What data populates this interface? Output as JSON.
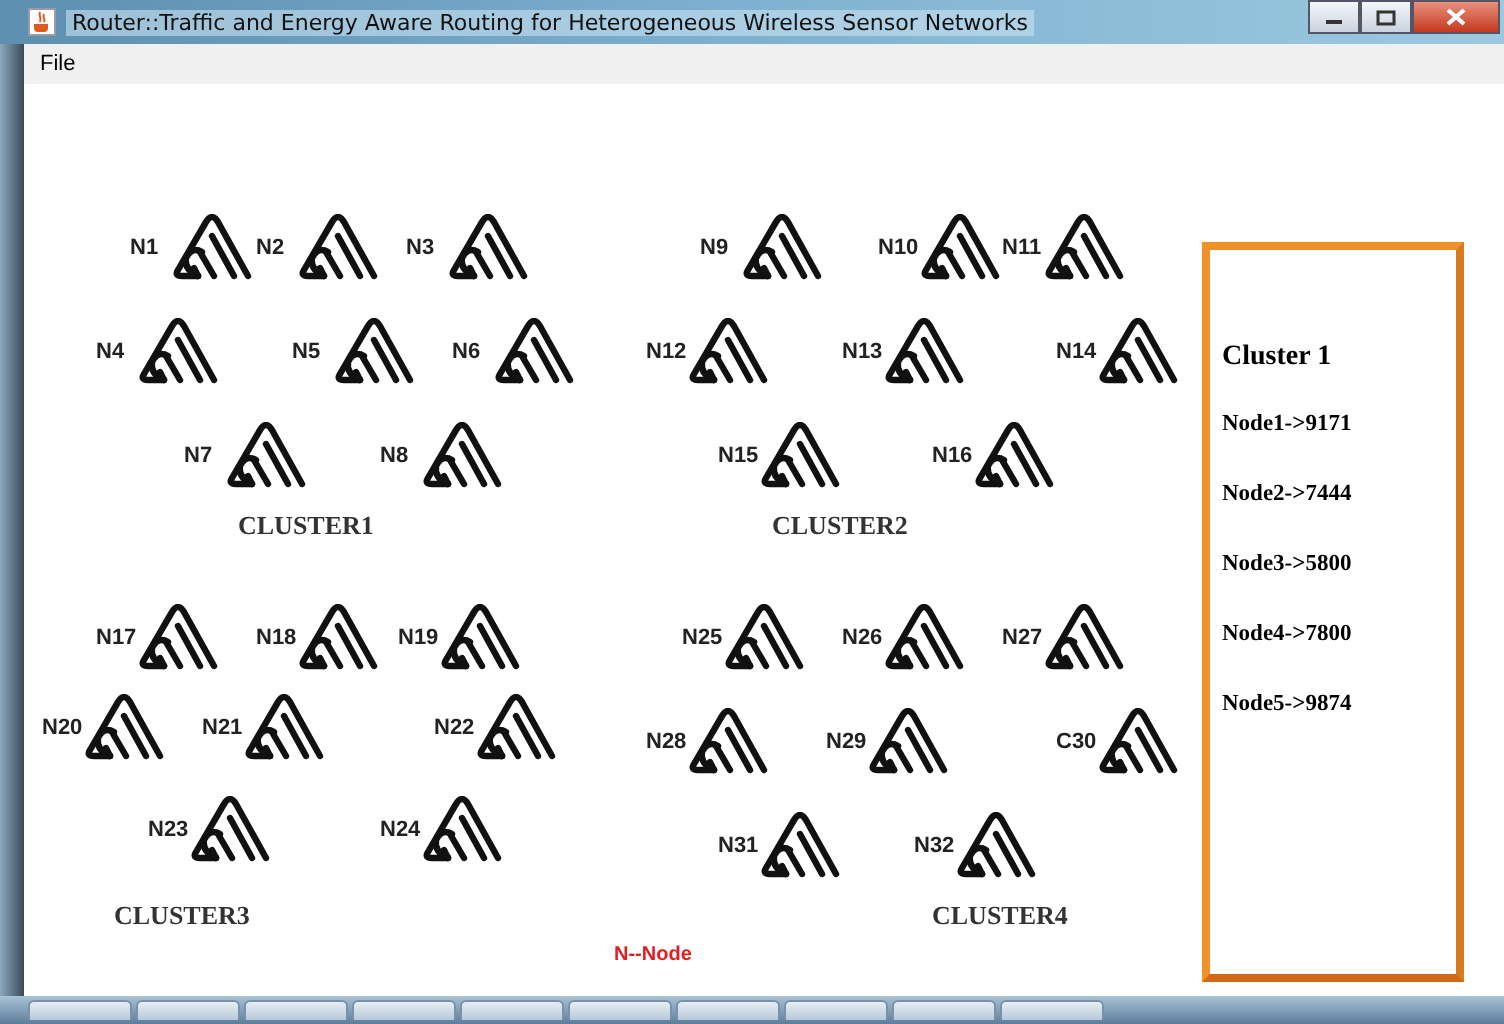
{
  "window": {
    "title": "Router::Traffic and Energy Aware Routing for Heterogeneous Wireless Sensor Networks"
  },
  "menu": [
    "File"
  ],
  "clusters": [
    {
      "label": "CLUSTER1",
      "nodes": [
        "N1",
        "N2",
        "N3",
        "N4",
        "N5",
        "N6",
        "N7",
        "N8"
      ]
    },
    {
      "label": "CLUSTER2",
      "nodes": [
        "N9",
        "N10",
        "N11",
        "N12",
        "N13",
        "N14",
        "N15",
        "N16"
      ]
    },
    {
      "label": "CLUSTER3",
      "nodes": [
        "N17",
        "N18",
        "N19",
        "N20",
        "N21",
        "N22",
        "N23",
        "N24"
      ]
    },
    {
      "label": "CLUSTER4",
      "nodes": [
        "N25",
        "N26",
        "N27",
        "N28",
        "N29",
        "C30",
        "N31",
        "N32"
      ]
    }
  ],
  "legend": "N--Node",
  "panel": {
    "title": "Cluster 1",
    "lines": [
      "Node1->9171",
      "Node2->7444",
      "Node3->5800",
      "Node4->7800",
      "Node5->9874"
    ]
  }
}
